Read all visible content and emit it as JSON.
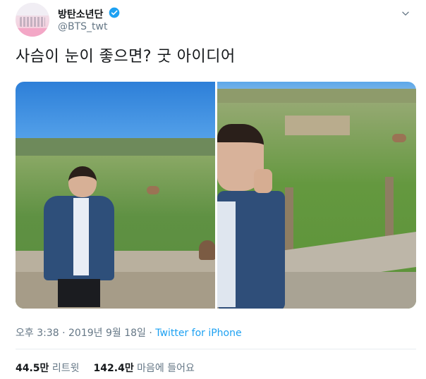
{
  "header": {
    "display_name": "방탄소년단",
    "handle": "@BTS_twt",
    "verified_icon": "verified-badge-icon",
    "more_icon": "chevron-down-icon"
  },
  "tweet": {
    "text": "사슴이 눈이 좋으면? 굿 아이디어"
  },
  "meta": {
    "time": "오후 3:38",
    "separator1": " · ",
    "date": "2019년 9월 18일",
    "separator2": " · ",
    "source": "Twitter for iPhone"
  },
  "stats": {
    "retweets_count": "44.5만",
    "retweets_label": "리트윗",
    "likes_count": "142.4만",
    "likes_label": "마음에 들어요"
  },
  "colors": {
    "link": "#1da1f2",
    "secondary_text": "#657786",
    "primary_text": "#14171a"
  }
}
